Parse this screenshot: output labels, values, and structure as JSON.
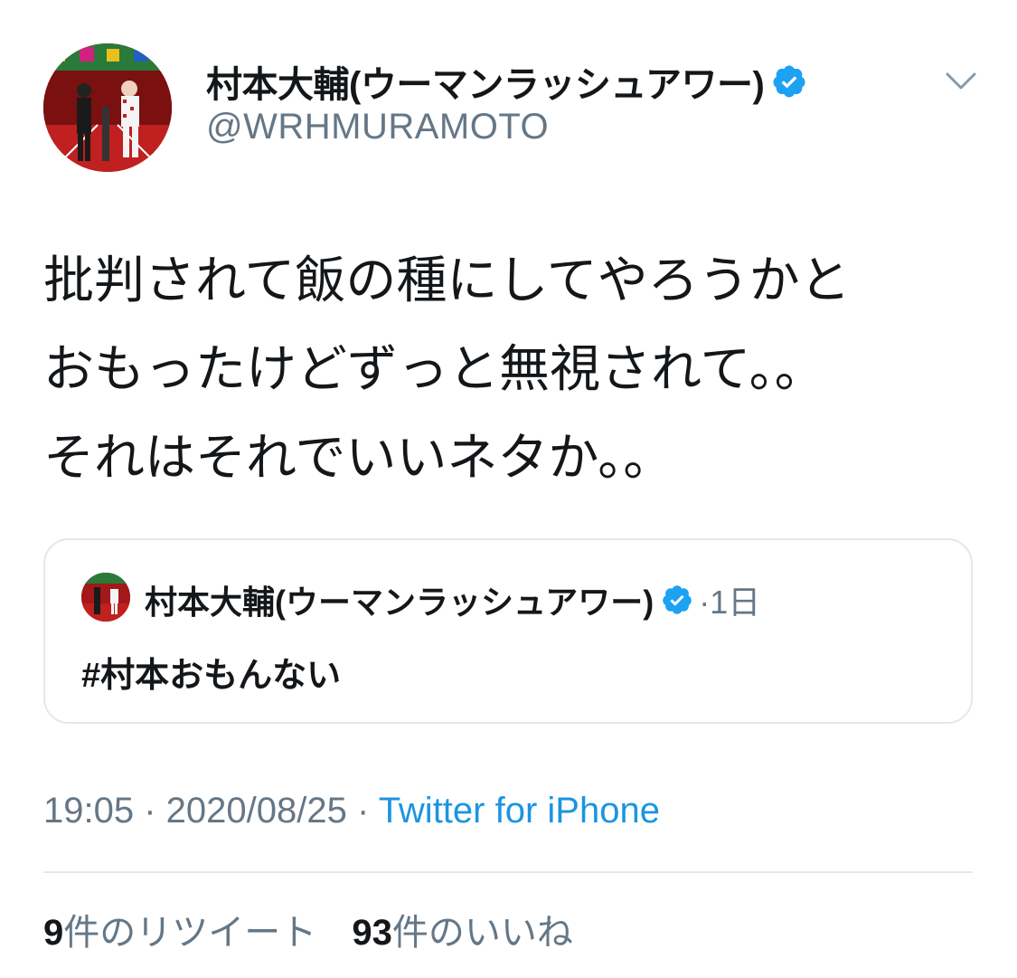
{
  "tweet": {
    "author": {
      "display_name": "村本大輔(ウーマンラッシュアワー)",
      "handle": "@WRHMURAMOTO",
      "verified_icon": "verified-badge-icon",
      "avatar": "profile-avatar"
    },
    "menu_icon": "chevron-down-icon",
    "text": "批判されて飯の種にしてやろうかと\nおもったけどずっと無視されて。。\nそれはそれでいいネタか。。",
    "quoted": {
      "display_name": "村本大輔(ウーマンラッシュアワー)",
      "time": "·1日",
      "text": "#村本おもんない"
    },
    "meta": {
      "time": "19:05",
      "separator1": " · ",
      "date": "2020/08/25",
      "separator2": " · ",
      "source": "Twitter for iPhone"
    },
    "stats": {
      "retweets_count": "9",
      "retweets_label": "件のリツイート",
      "likes_count": "93",
      "likes_label": "件のいいね"
    }
  },
  "colors": {
    "text_primary": "#14171a",
    "text_secondary": "#657786",
    "link": "#1b95e0",
    "verified": "#1da1f2",
    "border": "#e1e8ed"
  }
}
